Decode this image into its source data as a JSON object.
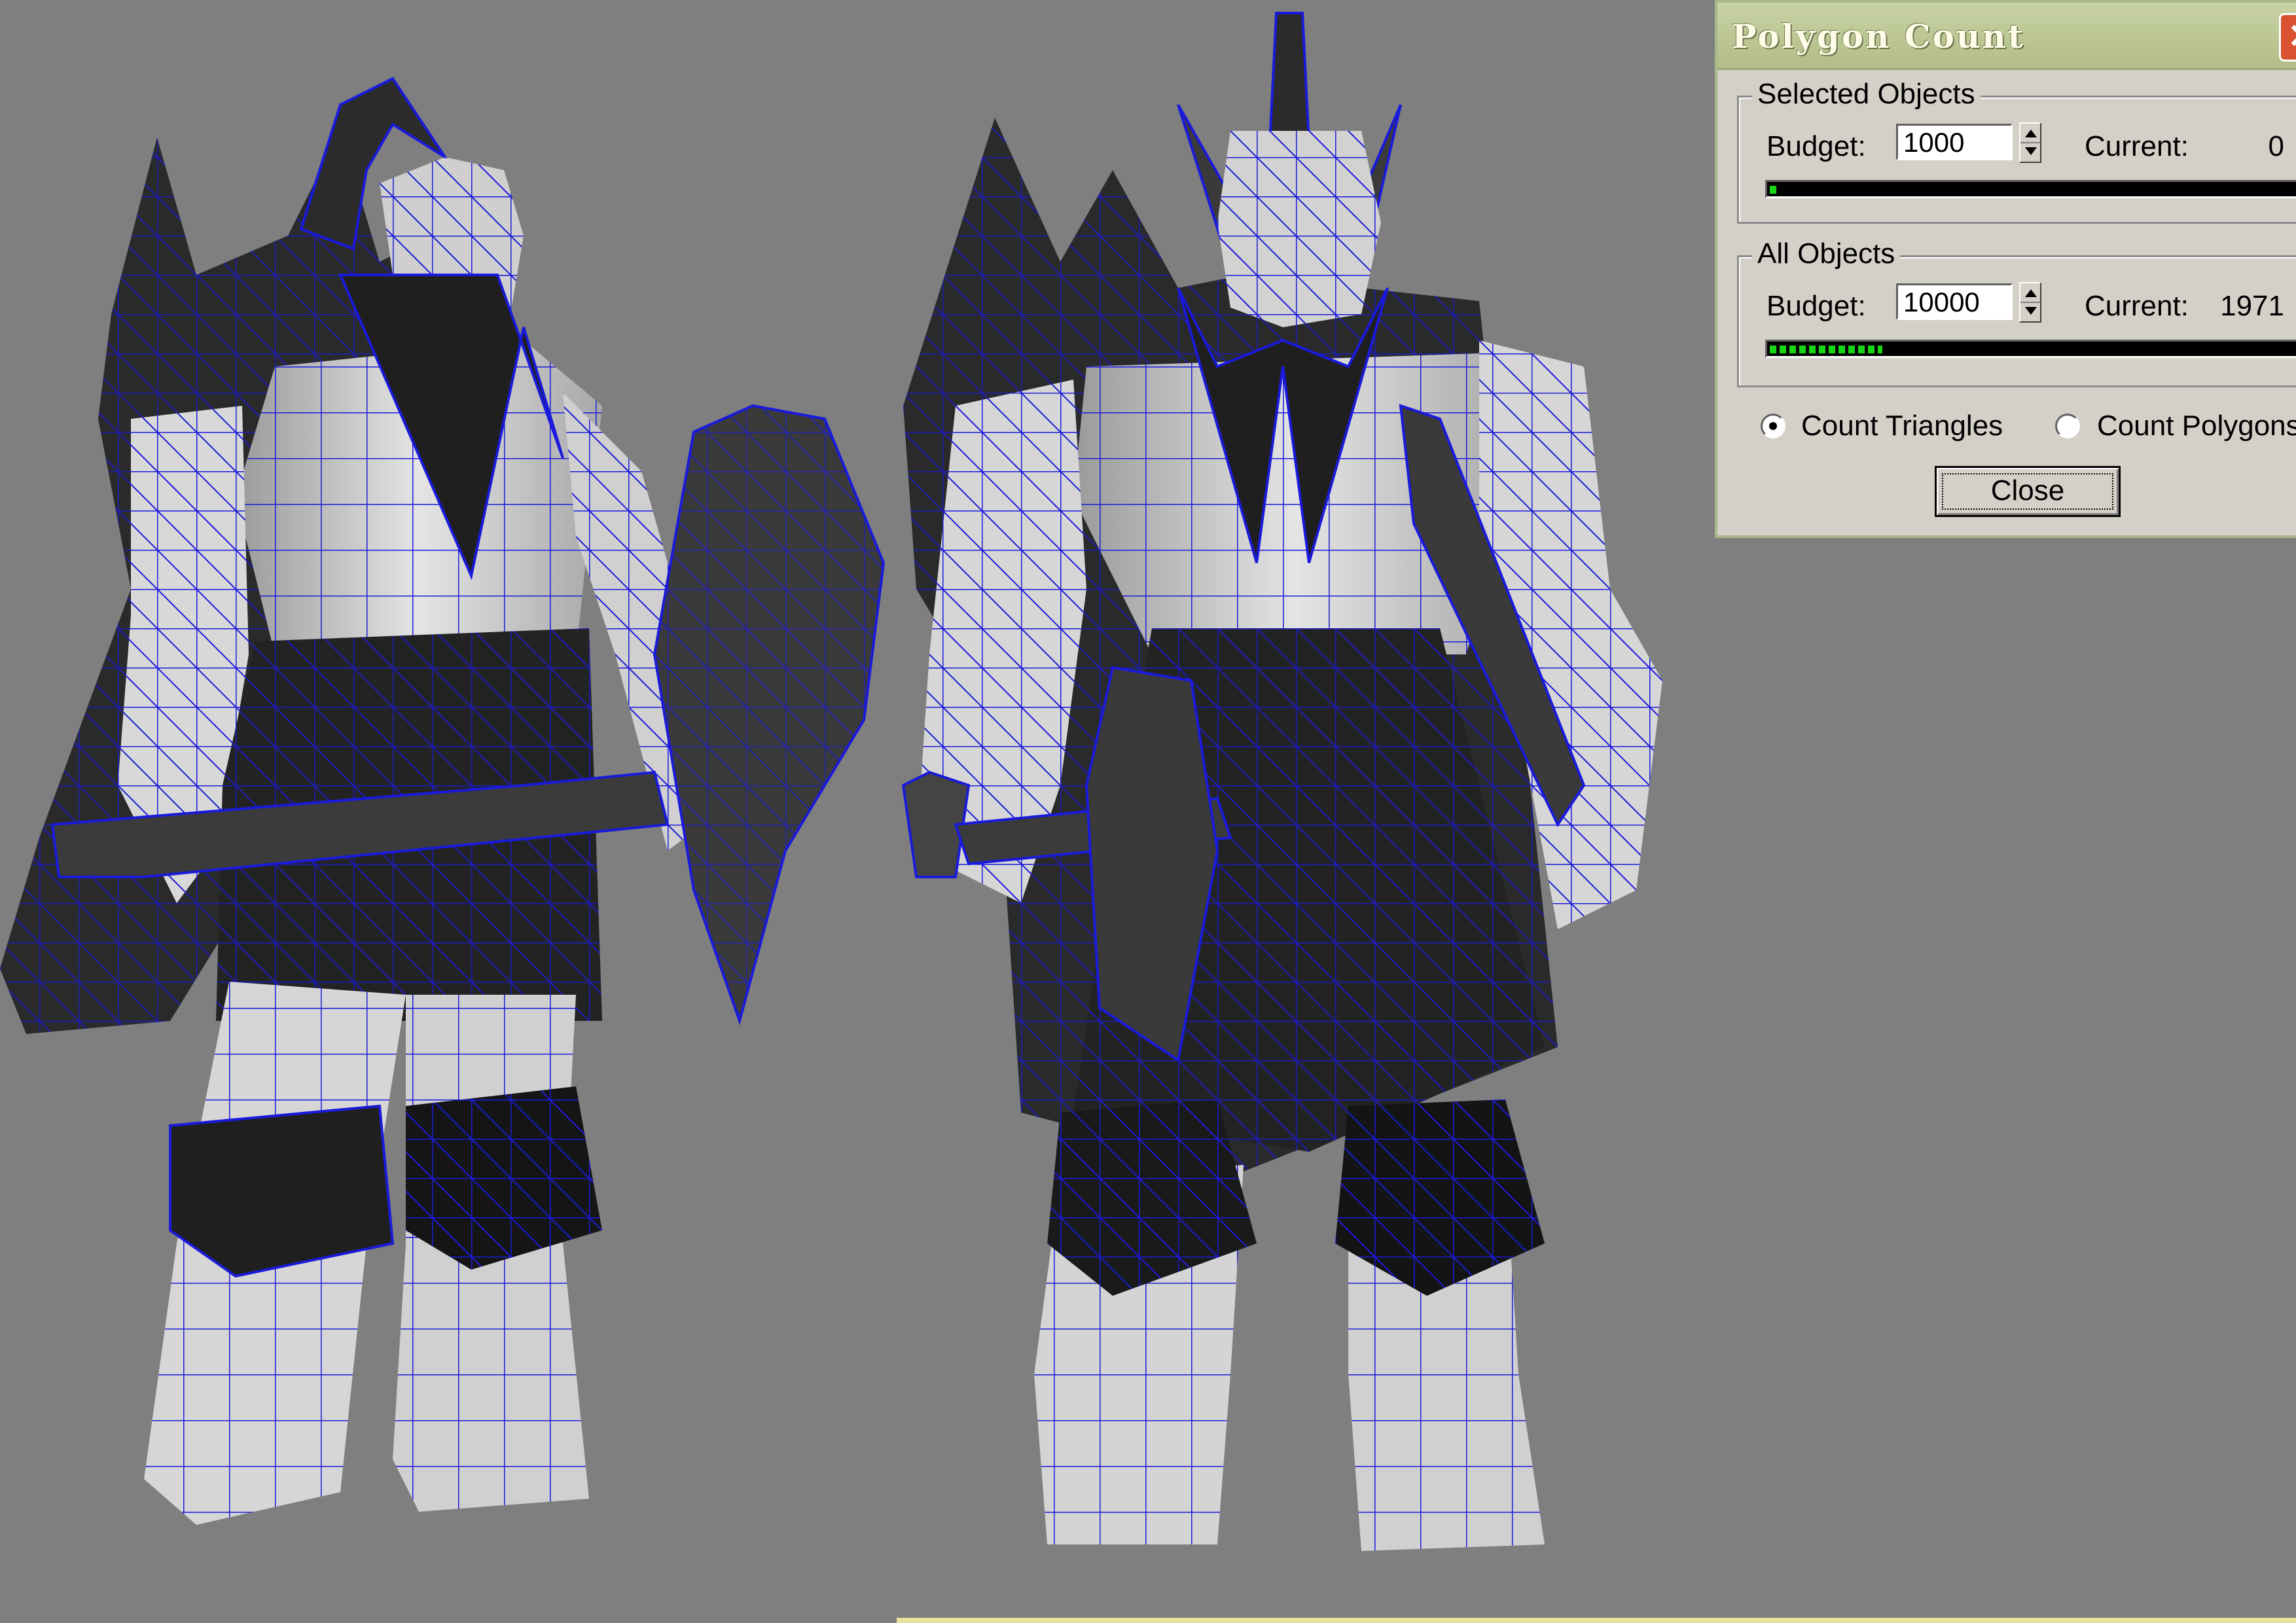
{
  "dialog": {
    "title": "Polygon Count",
    "selected": {
      "group_title": "Selected Objects",
      "budget_label": "Budget:",
      "budget_value": "1000",
      "current_label": "Current:",
      "current_value": "0",
      "progress": 0.01
    },
    "all": {
      "group_title": "All Objects",
      "budget_label": "Budget:",
      "budget_value": "10000",
      "current_label": "Current:",
      "current_value": "1971",
      "progress": 0.2
    },
    "options": {
      "count_triangles_label": "Count Triangles",
      "count_polygons_label": "Count Polygons",
      "selected": "Count Triangles"
    },
    "close_label": "Close"
  },
  "viewport": {
    "wire_color": "#1a1adc",
    "background_color": "#7f7f7f"
  }
}
